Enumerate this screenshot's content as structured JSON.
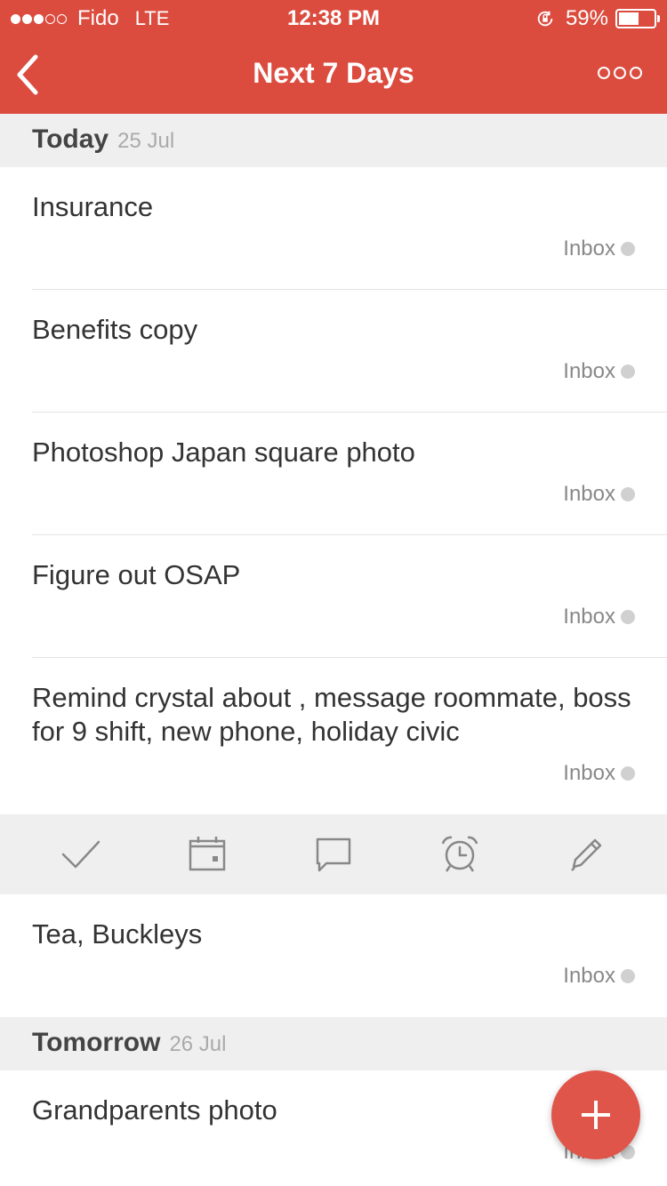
{
  "status_bar": {
    "carrier": "Fido",
    "network": "LTE",
    "time": "12:38 PM",
    "battery_percent": "59%",
    "battery_level": 0.59,
    "signal_bars_filled": 3,
    "signal_bars_total": 5
  },
  "nav": {
    "title": "Next 7 Days",
    "back_icon": "chevron-left-icon",
    "more_icon": "more-dots-icon"
  },
  "sections": [
    {
      "title": "Today",
      "date": "25 Jul",
      "tasks": [
        {
          "text": "Insurance",
          "project": "Inbox"
        },
        {
          "text": "Benefits copy",
          "project": "Inbox"
        },
        {
          "text": "Photoshop Japan square photo",
          "project": "Inbox"
        },
        {
          "text": "Figure out OSAP",
          "project": "Inbox"
        },
        {
          "text": "Remind crystal about , message roommate, boss for 9 shift, new phone, holiday civic",
          "project": "Inbox"
        },
        {
          "text": "Tea, Buckleys",
          "project": "Inbox"
        }
      ]
    },
    {
      "title": "Tomorrow",
      "date": "26 Jul",
      "tasks": [
        {
          "text": "Grandparents photo",
          "project": "Inbox"
        }
      ]
    }
  ],
  "action_toolbar": {
    "icons": [
      "checkmark-icon",
      "calendar-icon",
      "comment-icon",
      "alarm-clock-icon",
      "pencil-icon"
    ]
  },
  "fab": {
    "icon": "plus-icon"
  },
  "colors": {
    "accent": "#db4c3f",
    "section_bg": "#efefef",
    "project_dot": "#d0d0d0",
    "fab": "#e0554a"
  }
}
